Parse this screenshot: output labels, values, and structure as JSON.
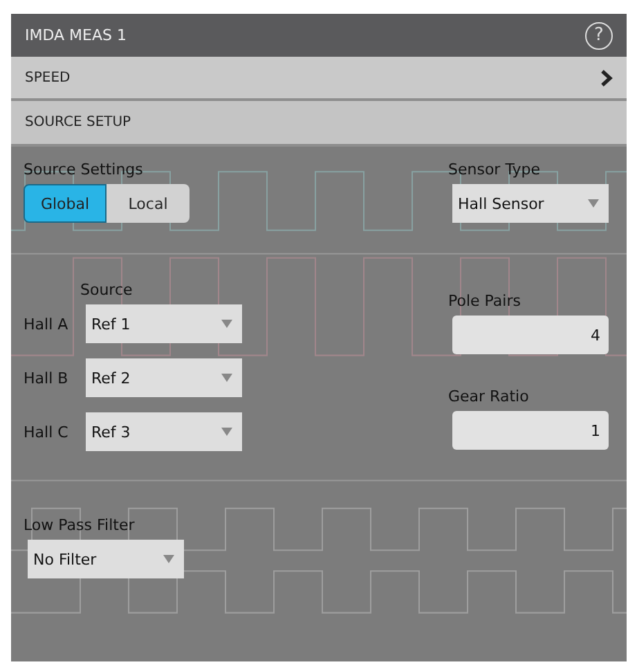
{
  "window": {
    "title": "IMDA MEAS 1",
    "help_icon": "?"
  },
  "sections": [
    {
      "label": "SPEED",
      "kind": "link"
    },
    {
      "label": "SOURCE SETUP",
      "kind": "header"
    }
  ],
  "source_settings": {
    "label": "Source Settings",
    "options": [
      {
        "label": "Global",
        "selected": true
      },
      {
        "label": "Local",
        "selected": false
      }
    ]
  },
  "sensor_type": {
    "label": "Sensor Type",
    "value": "Hall Sensor"
  },
  "source": {
    "label": "Source",
    "rows": [
      {
        "label": "Hall A",
        "value": "Ref 1"
      },
      {
        "label": "Hall B",
        "value": "Ref 2"
      },
      {
        "label": "Hall C",
        "value": "Ref 3"
      }
    ]
  },
  "pole_pairs": {
    "label": "Pole Pairs",
    "value": "4"
  },
  "gear_ratio": {
    "label": "Gear Ratio",
    "value": "1"
  },
  "low_pass_filter": {
    "label": "Low Pass Filter",
    "value": "No Filter"
  }
}
